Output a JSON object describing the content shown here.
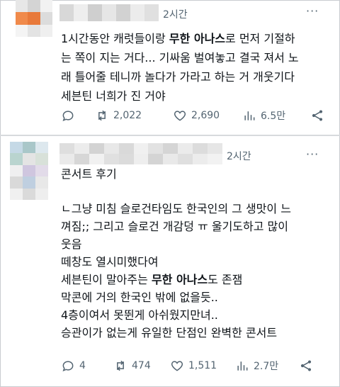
{
  "tweets": [
    {
      "time": "2시간",
      "more": "···",
      "lines": [
        [
          {
            "t": "1시간동안 캐럿들이랑 "
          },
          {
            "t": "무한 아나스",
            "b": true
          },
          {
            "t": "로 먼저 기절하"
          }
        ],
        [
          {
            "t": "는 쪽이 지는 거다... 기싸움 벌여놓고 결국 져서 노"
          }
        ],
        [
          {
            "t": "래 틀어줄 테니까 놀다가 가라고 하는 거 개웃기다"
          }
        ],
        [
          {
            "t": "세븐틴 너희가 진 거야"
          }
        ]
      ],
      "replies": "",
      "retweets": "2,022",
      "likes": "2,690",
      "views": "6.5만"
    },
    {
      "time": "2시간",
      "more": "···",
      "lines": [
        [
          {
            "t": "콘서트 후기"
          }
        ],
        null,
        [
          {
            "t": "ㄴ그냥 미침 슬로건타임도 한국인의 그 생맛이 느"
          }
        ],
        [
          {
            "t": "껴짐;; 그리고 슬로건 개감덩 ㅠ 울기도하고 많이"
          }
        ],
        [
          {
            "t": "웃음"
          }
        ],
        [
          {
            "t": "떼창도 열시미했다여"
          }
        ],
        [
          {
            "t": "세븐틴이 말아주는 "
          },
          {
            "t": "무한 아나스",
            "b": true
          },
          {
            "t": "도 존잼"
          }
        ],
        [
          {
            "t": "막콘에 거의 한국인 밖에 없을듯.."
          }
        ],
        [
          {
            "t": "4층이여서 못뛴게 아쉬웠지만녀.."
          }
        ],
        [
          {
            "t": "승관이가 없는게 유일한 단점인 완벽한 콘서트"
          }
        ]
      ],
      "replies": "4",
      "retweets": "474",
      "likes": "1,511",
      "views": "2.7만"
    }
  ],
  "colors": {
    "text": "#0f1419",
    "muted": "#536471",
    "avatar1": [
      "#e7e7e7",
      "#d4d4d4",
      "#f2f2f2",
      "#f08a4b",
      "#e8793a",
      "#dcdcdc",
      "#f4f4f4",
      "#e3e3e3",
      "#efefef"
    ],
    "name1": [
      "#d8d8d8",
      "#eeeeee",
      "#cfcfcf",
      "#e6e6e6",
      "#d2d2d2",
      "#ececec",
      "#e0e0e0"
    ],
    "avatar2": [
      "#c5d9e6",
      "#a9c7c9",
      "#dde8ee",
      "#b9d4cf",
      "#e4e4e4",
      "#d8e1d9",
      "#efeff0",
      "#cfc6df",
      "#e2dbe9",
      "#d9d9d9",
      "#bfcfe0",
      "#e8e8e8",
      "#f0f0f0",
      "#dadada",
      "#eeeeee"
    ],
    "name2": [
      "#dedede",
      "#ececec",
      "#d3d3d3",
      "#e8e8e8",
      "#d9d9d9",
      "#f0f0f0",
      "#e2e2e2",
      "#d5d5d5",
      "#ebebeb",
      "#dcdcdc",
      "#e6e6e6",
      "#eaeaea",
      "#d7d7d7",
      "#f1f1f1",
      "#e0e0e0",
      "#dbdbdb",
      "#eeeeee",
      "#d4d4d4",
      "#e9e9e9",
      "#dfdfdf",
      "#ececec",
      "#f2f2f2"
    ]
  },
  "icons": [
    "reply-icon",
    "retweet-icon",
    "like-icon",
    "views-icon",
    "share-icon"
  ]
}
